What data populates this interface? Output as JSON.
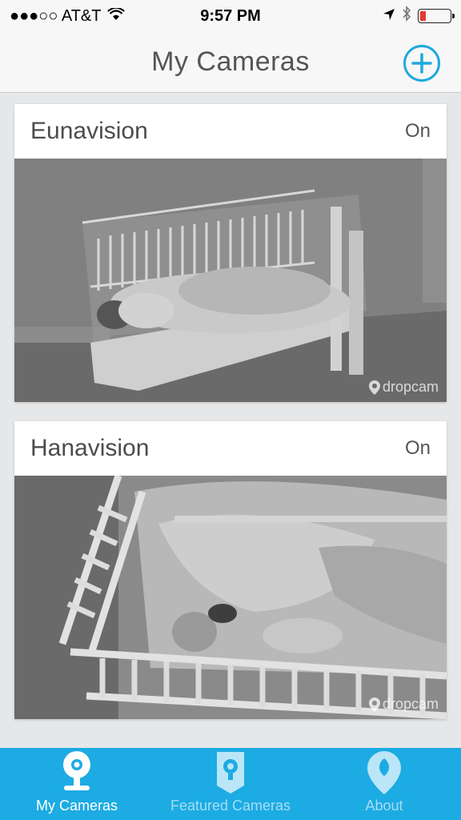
{
  "status_bar": {
    "carrier": "●●●○○ AT&T",
    "time": "9:57 PM"
  },
  "nav": {
    "title": "My Cameras"
  },
  "cameras": [
    {
      "name": "Eunavision",
      "status": "On",
      "watermark": "dropcam"
    },
    {
      "name": "Hanavision",
      "status": "On",
      "watermark": "dropcam"
    }
  ],
  "tabs": [
    {
      "label": "My Cameras",
      "icon": "camera-icon",
      "active": true
    },
    {
      "label": "Featured Cameras",
      "icon": "ribbon-icon",
      "active": false
    },
    {
      "label": "About",
      "icon": "location-pin-icon",
      "active": false
    }
  ],
  "colors": {
    "accent": "#1cabe3",
    "battery_low": "#e53935"
  }
}
